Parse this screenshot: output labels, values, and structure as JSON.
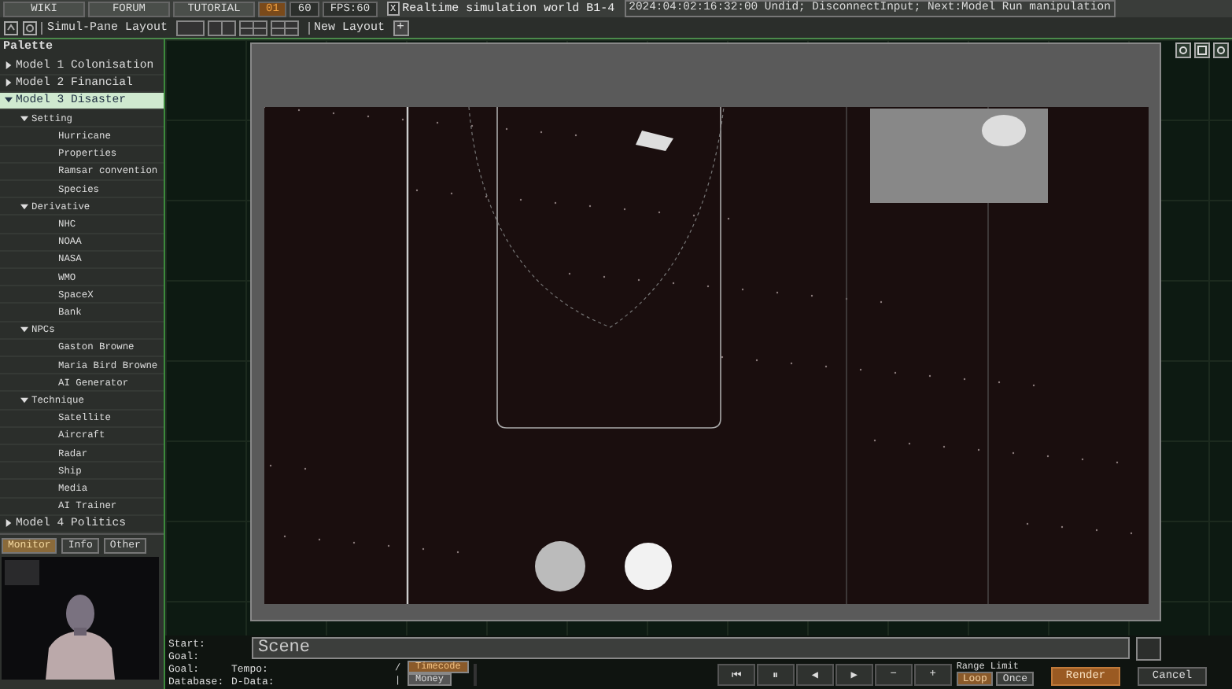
{
  "top_bar": {
    "links": [
      {
        "label": "WIKI"
      },
      {
        "label": "FORUM"
      },
      {
        "label": "TUTORIAL"
      }
    ],
    "counters": [
      {
        "text": "01",
        "highlight": true
      },
      {
        "text": "60",
        "highlight": false
      },
      {
        "text": "FPS:60",
        "highlight": false
      }
    ],
    "realtime": {
      "mark": "X",
      "checked": true,
      "label": "Realtime simulation world B1-4"
    },
    "status": "2024:04:02:16:32:00 Undid; DisconnectInput; Next:Model Run manipulation"
  },
  "layout_bar": {
    "label": "Simul-Pane Layout",
    "new_layout": "New Layout",
    "add": "+"
  },
  "palette": {
    "title": "Palette",
    "items": [
      {
        "label": "Model 1 Colonisation",
        "expanded": false,
        "selected": false
      },
      {
        "label": "Model 2 Financial",
        "expanded": false,
        "selected": false
      },
      {
        "label": "Model 3 Disaster",
        "expanded": true,
        "selected": true,
        "children": [
          {
            "label": "Setting",
            "expanded": true,
            "selected": false,
            "children": [
              {
                "label": "Hurricane",
                "selected": false
              },
              {
                "label": "Properties",
                "selected": false
              },
              {
                "label": "Ramsar convention",
                "selected": false
              },
              {
                "label": "Species",
                "selected": false
              }
            ]
          },
          {
            "label": "Derivative",
            "expanded": true,
            "selected": false,
            "children": [
              {
                "label": "NHC",
                "selected": false
              },
              {
                "label": "NOAA",
                "selected": false
              },
              {
                "label": "NASA",
                "selected": false
              },
              {
                "label": "WMO",
                "selected": false
              },
              {
                "label": "SpaceX",
                "selected": false
              },
              {
                "label": "Bank",
                "selected": false
              }
            ]
          },
          {
            "label": "NPCs",
            "expanded": true,
            "selected": false,
            "children": [
              {
                "label": "Gaston Browne",
                "selected": false
              },
              {
                "label": "Maria Bird Browne",
                "selected": false
              },
              {
                "label": "AI Generator",
                "selected": false
              }
            ]
          },
          {
            "label": "Technique",
            "expanded": true,
            "selected": false,
            "children": [
              {
                "label": "Satellite",
                "selected": false
              },
              {
                "label": "Aircraft",
                "selected": false
              },
              {
                "label": "Radar",
                "selected": false
              },
              {
                "label": "Ship",
                "selected": false
              },
              {
                "label": "Media",
                "selected": false
              },
              {
                "label": "AI Trainer",
                "selected": false
              }
            ]
          }
        ]
      },
      {
        "label": "Model 4 Politics",
        "expanded": false,
        "selected": false
      }
    ]
  },
  "monitor_tabs": [
    {
      "label": "Monitor",
      "selected": true
    },
    {
      "label": "Info",
      "selected": false
    },
    {
      "label": "Other",
      "selected": false
    }
  ],
  "scene": {
    "placeholder": "Scene"
  },
  "stats": [
    {
      "label": "Start:"
    },
    {
      "label": "Goal:"
    },
    {
      "label": "Goal:",
      "extra": "Tempo:"
    },
    {
      "label": "Database:",
      "extra": "D-Data:"
    }
  ],
  "side_buttons": [
    {
      "key": "/",
      "label": "Timecode",
      "selected": true
    },
    {
      "key": "|",
      "label": "Money",
      "selected": false
    }
  ],
  "transport": [
    {
      "label": "⏮"
    },
    {
      "label": "⏸"
    },
    {
      "label": "◀"
    },
    {
      "label": "▶"
    },
    {
      "label": "−"
    },
    {
      "label": "+"
    }
  ],
  "range_limit": {
    "label": "Range Limit",
    "options": [
      {
        "label": "Loop",
        "selected": true
      },
      {
        "label": "Once",
        "selected": false
      }
    ]
  },
  "actions": [
    {
      "label": "Render",
      "primary": true
    },
    {
      "label": "Cancel",
      "primary": false
    }
  ]
}
